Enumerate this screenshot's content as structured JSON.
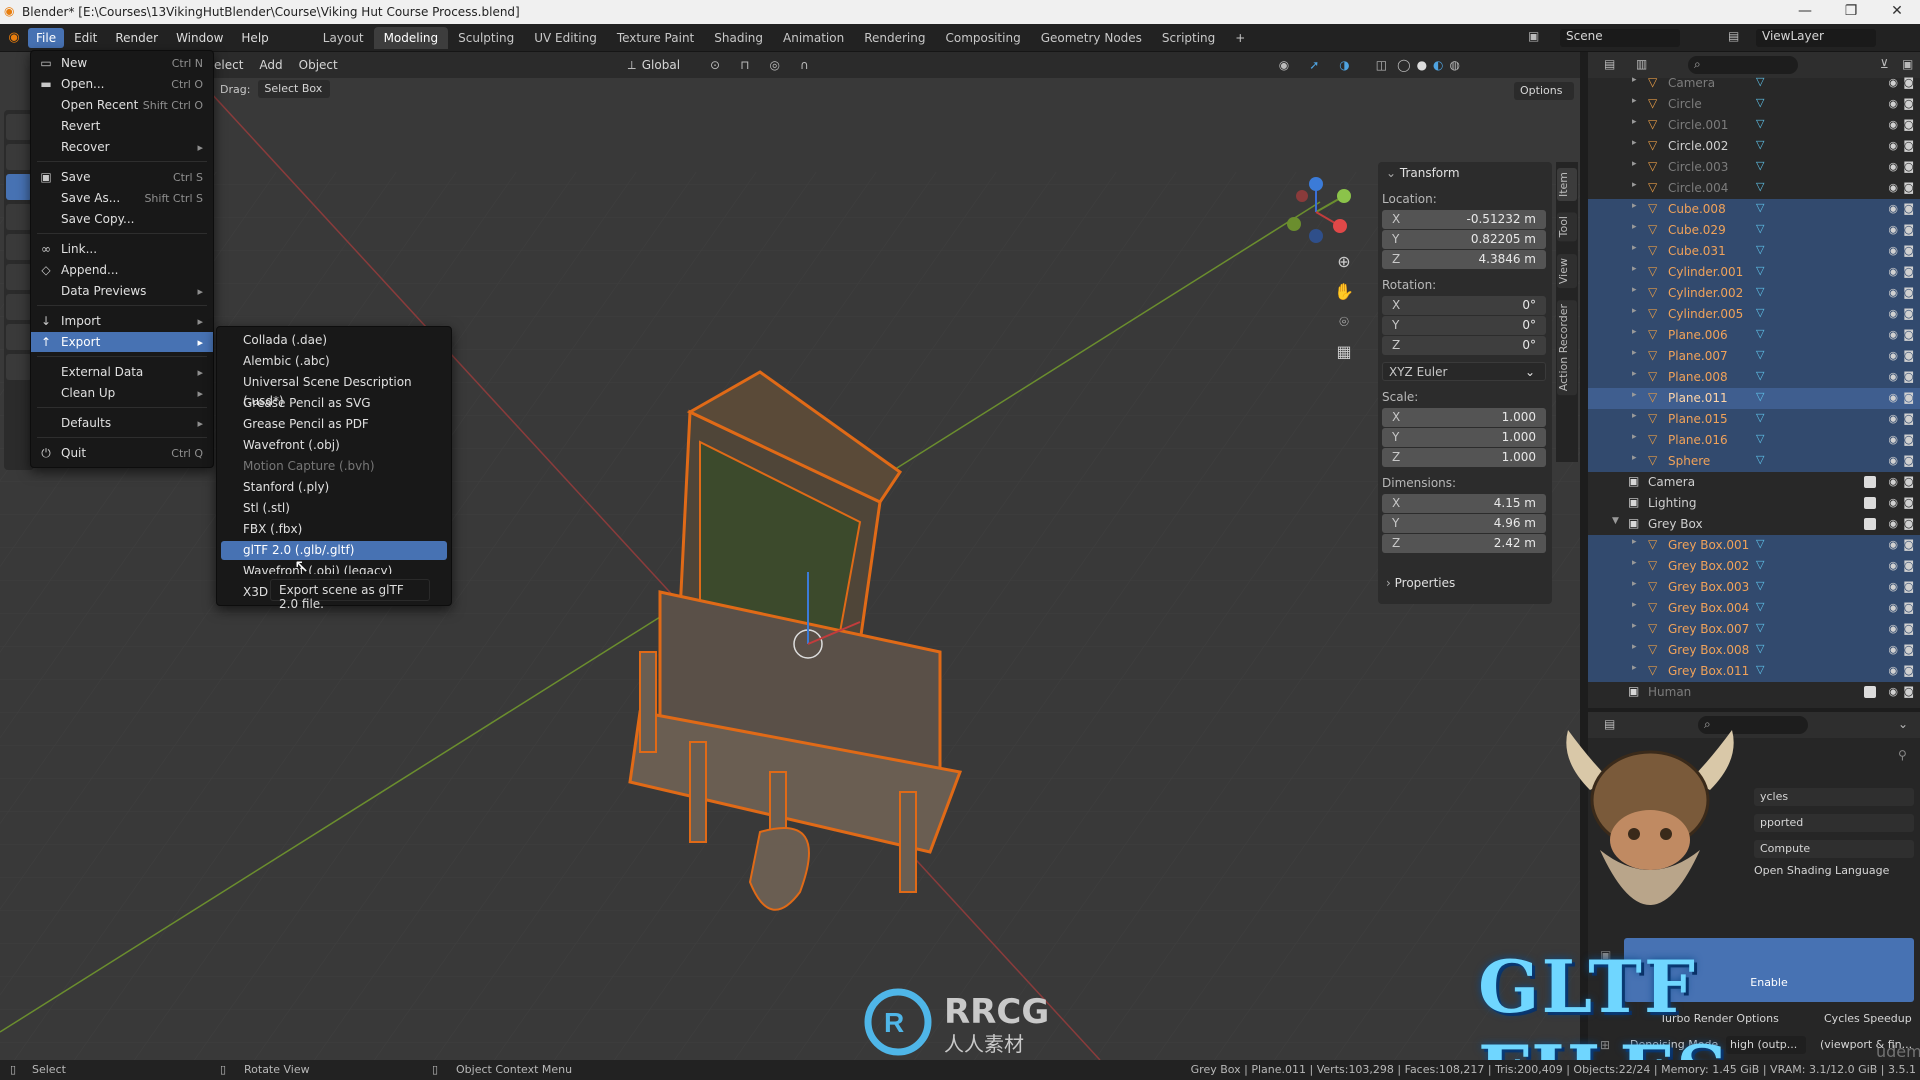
{
  "window": {
    "title": "Blender* [E:\\Courses\\13VikingHutBlender\\Course\\Viking Hut Course Process.blend]",
    "controls": [
      "—",
      "❐",
      "✕"
    ]
  },
  "menubar": {
    "menus": [
      "File",
      "Edit",
      "Render",
      "Window",
      "Help"
    ],
    "workspaces": [
      "Layout",
      "Modeling",
      "Sculpting",
      "UV Editing",
      "Texture Paint",
      "Shading",
      "Animation",
      "Rendering",
      "Compositing",
      "Geometry Nodes",
      "Scripting"
    ],
    "active_workspace": "Modeling",
    "add_tab": "+",
    "scene_label": "Scene",
    "view_layer_label": "ViewLayer"
  },
  "viewport_header": {
    "menu_items": [
      "elect",
      "Add",
      "Object"
    ],
    "orientation": "Global",
    "drag_label": "Drag:",
    "drag_value": "Select Box",
    "options_label": "Options"
  },
  "file_menu": {
    "items": [
      {
        "label": "New",
        "shortcut": "Ctrl N",
        "icon": "new-file-icon",
        "arrow": true
      },
      {
        "label": "Open...",
        "shortcut": "Ctrl O",
        "icon": "open-folder-icon"
      },
      {
        "label": "Open Recent",
        "shortcut": "Shift Ctrl O",
        "arrow": true
      },
      {
        "label": "Revert",
        "shortcut": ""
      },
      {
        "label": "Recover",
        "shortcut": "",
        "arrow": true
      },
      {
        "label": "Save",
        "shortcut": "Ctrl S",
        "icon": "save-icon"
      },
      {
        "label": "Save As...",
        "shortcut": "Shift Ctrl S"
      },
      {
        "label": "Save Copy...",
        "shortcut": ""
      },
      {
        "label": "Link...",
        "shortcut": "",
        "icon": "link-icon"
      },
      {
        "label": "Append...",
        "shortcut": "",
        "icon": "append-icon"
      },
      {
        "label": "Data Previews",
        "shortcut": "",
        "arrow": true
      },
      {
        "label": "Import",
        "shortcut": "",
        "icon": "import-icon",
        "arrow": true
      },
      {
        "label": "Export",
        "shortcut": "",
        "icon": "export-icon",
        "arrow": true,
        "highlight": true
      },
      {
        "label": "External Data",
        "shortcut": "",
        "arrow": true
      },
      {
        "label": "Clean Up",
        "shortcut": "",
        "arrow": true
      },
      {
        "label": "Defaults",
        "shortcut": "",
        "arrow": true
      },
      {
        "label": "Quit",
        "shortcut": "Ctrl Q",
        "icon": "quit-icon"
      }
    ]
  },
  "export_menu": {
    "items": [
      {
        "label": "Collada (.dae)"
      },
      {
        "label": "Alembic (.abc)"
      },
      {
        "label": "Universal Scene Description (.usd*)"
      },
      {
        "label": "Grease Pencil as SVG"
      },
      {
        "label": "Grease Pencil as PDF"
      },
      {
        "label": "Wavefront (.obj)"
      },
      {
        "label": "Motion Capture (.bvh)",
        "disabled": true
      },
      {
        "label": "Stanford (.ply)"
      },
      {
        "label": "Stl (.stl)"
      },
      {
        "label": "FBX (.fbx)"
      },
      {
        "label": "glTF 2.0 (.glb/.gltf)",
        "highlight": true
      },
      {
        "label": "Wavefront (.obj) (legacy)"
      },
      {
        "label": "X3D"
      }
    ],
    "tooltip": "Export scene as glTF 2.0 file."
  },
  "n_panel": {
    "tabs": [
      "Item",
      "Tool",
      "View",
      "Action Recorder"
    ],
    "transform_label": "Transform",
    "location_label": "Location:",
    "location": [
      {
        "axis": "X",
        "value": "-0.51232 m"
      },
      {
        "axis": "Y",
        "value": "0.82205 m"
      },
      {
        "axis": "Z",
        "value": "4.3846 m"
      }
    ],
    "rotation_label": "Rotation:",
    "rotation": [
      {
        "axis": "X",
        "value": "0°"
      },
      {
        "axis": "Y",
        "value": "0°"
      },
      {
        "axis": "Z",
        "value": "0°"
      }
    ],
    "rotation_mode": "XYZ Euler",
    "scale_label": "Scale:",
    "scale": [
      {
        "axis": "X",
        "value": "1.000"
      },
      {
        "axis": "Y",
        "value": "1.000"
      },
      {
        "axis": "Z",
        "value": "1.000"
      }
    ],
    "dimensions_label": "Dimensions:",
    "dimensions": [
      {
        "axis": "X",
        "value": "4.15 m"
      },
      {
        "axis": "Y",
        "value": "4.96 m"
      },
      {
        "axis": "Z",
        "value": "2.42 m"
      }
    ],
    "properties_label": "Properties"
  },
  "outliner": {
    "rows": [
      {
        "name": "Camera",
        "type": "object",
        "state": "dim"
      },
      {
        "name": "Circle",
        "type": "object",
        "state": "dim"
      },
      {
        "name": "Circle.001",
        "type": "object",
        "state": "dim"
      },
      {
        "name": "Circle.002",
        "type": "object",
        "state": "normal"
      },
      {
        "name": "Circle.003",
        "type": "object",
        "state": "dim"
      },
      {
        "name": "Circle.004",
        "type": "object",
        "state": "dim"
      },
      {
        "name": "Cube.008",
        "type": "object",
        "state": "selected"
      },
      {
        "name": "Cube.029",
        "type": "object",
        "state": "selected"
      },
      {
        "name": "Cube.031",
        "type": "object",
        "state": "selected"
      },
      {
        "name": "Cylinder.001",
        "type": "object",
        "state": "selected"
      },
      {
        "name": "Cylinder.002",
        "type": "object",
        "state": "selected"
      },
      {
        "name": "Cylinder.005",
        "type": "object",
        "state": "selected"
      },
      {
        "name": "Plane.006",
        "type": "object",
        "state": "selected"
      },
      {
        "name": "Plane.007",
        "type": "object",
        "state": "selected"
      },
      {
        "name": "Plane.008",
        "type": "object",
        "state": "selected"
      },
      {
        "name": "Plane.011",
        "type": "object",
        "state": "active"
      },
      {
        "name": "Plane.015",
        "type": "object",
        "state": "selected"
      },
      {
        "name": "Plane.016",
        "type": "object",
        "state": "selected"
      },
      {
        "name": "Sphere",
        "type": "object",
        "state": "selected"
      },
      {
        "name": "Camera",
        "type": "collection",
        "state": "normal"
      },
      {
        "name": "Lighting",
        "type": "collection",
        "state": "normal"
      },
      {
        "name": "Grey Box",
        "type": "collection",
        "state": "normal"
      },
      {
        "name": "Grey Box.001",
        "type": "object",
        "state": "selected"
      },
      {
        "name": "Grey Box.002",
        "type": "object",
        "state": "selected"
      },
      {
        "name": "Grey Box.003",
        "type": "object",
        "state": "selected"
      },
      {
        "name": "Grey Box.004",
        "type": "object",
        "state": "selected"
      },
      {
        "name": "Grey Box.007",
        "type": "object",
        "state": "selected"
      },
      {
        "name": "Grey Box.008",
        "type": "object",
        "state": "selected"
      },
      {
        "name": "Grey Box.011",
        "type": "object",
        "state": "selected"
      },
      {
        "name": "Human",
        "type": "collection",
        "state": "dim"
      }
    ]
  },
  "properties": {
    "rows": [
      {
        "label": "",
        "value": "ycles"
      },
      {
        "label": "",
        "value": "pported"
      },
      {
        "label": "",
        "value": "Compute"
      },
      {
        "label": "",
        "value": "Open Shading Language"
      }
    ],
    "enable_button": "Enable",
    "turbo_label": "Turbo Render Options",
    "speedup_label": "Cycles Speedup",
    "denoising_label": "Denoising Mode",
    "denoising_value": "high (outp...",
    "viewport_value": "(viewport & fin..."
  },
  "overlay": {
    "big_title": "GLTF FILES",
    "rrcg_text": "RRCG",
    "rrcg_sub": "人人素材",
    "udemy": "udemy"
  },
  "statusbar": {
    "left": [
      {
        "key": "Select"
      },
      {
        "key": "Rotate View"
      },
      {
        "key": "Object Context Menu"
      }
    ],
    "stats": "Grey Box | Plane.011 | Verts:103,298 | Faces:108,217 | Tris:200,409 | Objects:22/24 | Memory: 1.45 GiB | VRAM: 3.1/12.0 GiB | 3.5.1"
  },
  "colors": {
    "accent": "#4772b3",
    "selection": "#e06a17",
    "object_orange": "#e39a46",
    "title_blue": "#6fd6ff"
  }
}
